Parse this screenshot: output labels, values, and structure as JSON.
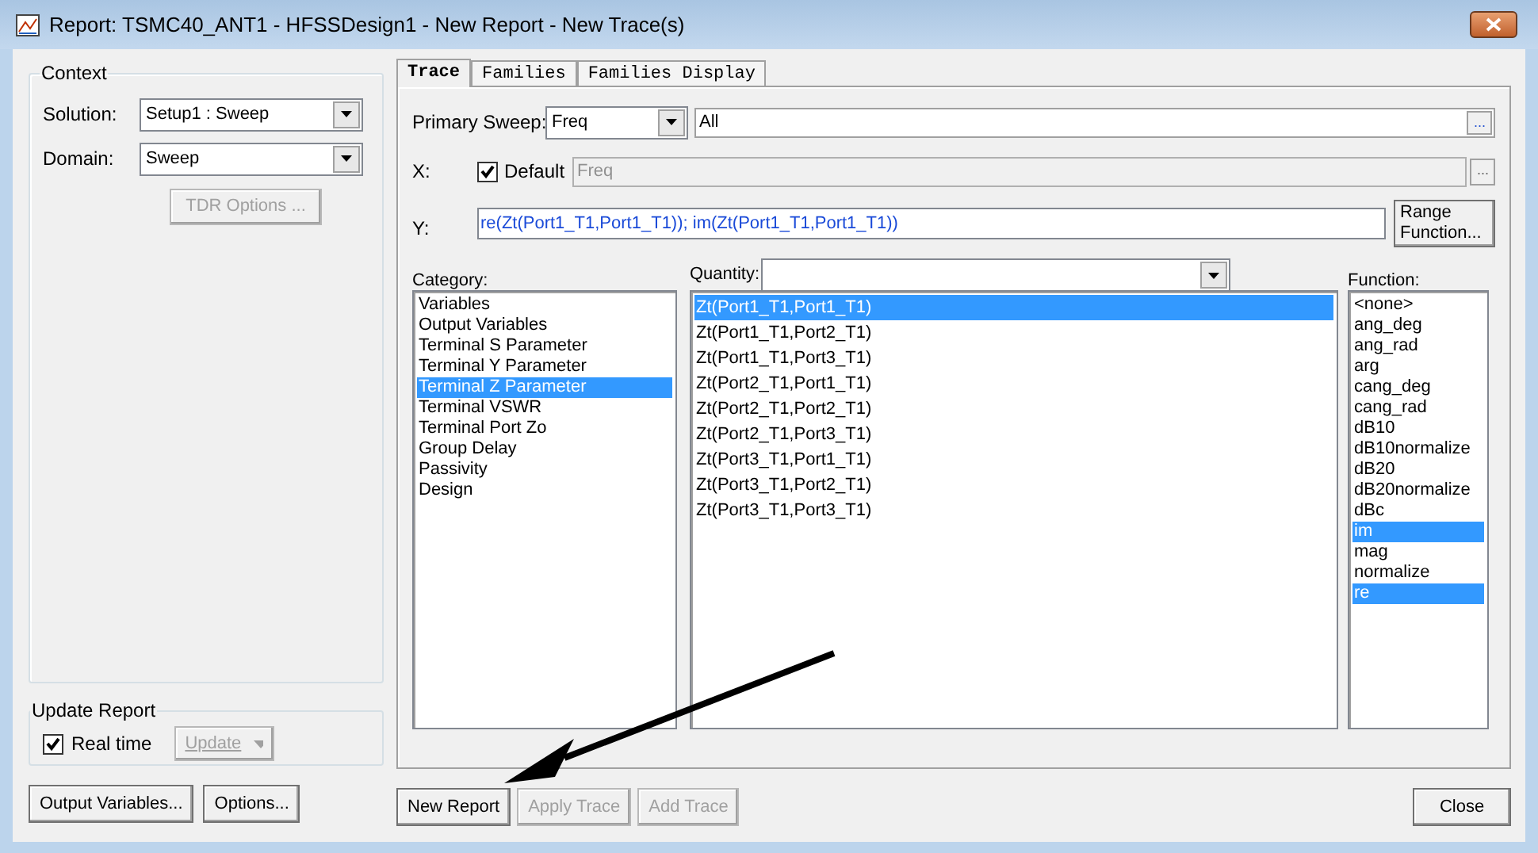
{
  "window": {
    "title": "Report: TSMC40_ANT1 - HFSSDesign1 - New Report - New Trace(s)"
  },
  "context": {
    "title": "Context",
    "fields": [
      {
        "label": "Solution:",
        "value": "Setup1 : Sweep"
      },
      {
        "label": "Domain:",
        "value": "Sweep"
      }
    ],
    "tdr_button": {
      "label": "TDR Options ...",
      "disabled": true
    }
  },
  "update_report": {
    "title": "Update Report",
    "real_time": {
      "label": "Real time",
      "checked": true
    },
    "update_button": {
      "label": "Update",
      "disabled": true
    }
  },
  "left_buttons": [
    {
      "label": "Output Variables...",
      "disabled": false
    },
    {
      "label": "Options...",
      "disabled": false
    }
  ],
  "tabs": [
    {
      "label": "Trace",
      "selected": true
    },
    {
      "label": "Families",
      "selected": false
    },
    {
      "label": "Families Display",
      "selected": false
    }
  ],
  "primary_sweep": {
    "label": "Primary Sweep:",
    "value": "Freq",
    "range": "All",
    "more": "..."
  },
  "x": {
    "label": "X:",
    "default_label": "Default",
    "default_checked": true,
    "value": "Freq",
    "more": "..."
  },
  "y": {
    "label": "Y:",
    "value": "re(Zt(Port1_T1,Port1_T1)); im(Zt(Port1_T1,Port1_T1))",
    "range_button": "Range Function..."
  },
  "category": {
    "label": "Category:",
    "items": [
      {
        "label": "Variables",
        "selected": false
      },
      {
        "label": "Output Variables",
        "selected": false
      },
      {
        "label": "Terminal S Parameter",
        "selected": false
      },
      {
        "label": "Terminal Y Parameter",
        "selected": false
      },
      {
        "label": "Terminal Z Parameter",
        "selected": true
      },
      {
        "label": "Terminal VSWR",
        "selected": false
      },
      {
        "label": "Terminal Port Zo",
        "selected": false
      },
      {
        "label": "Group Delay",
        "selected": false
      },
      {
        "label": "Passivity",
        "selected": false
      },
      {
        "label": "Design",
        "selected": false
      }
    ]
  },
  "quantity": {
    "label": "Quantity:",
    "items": [
      {
        "label": "Zt(Port1_T1,Port1_T1)",
        "selected": true
      },
      {
        "label": "Zt(Port1_T1,Port2_T1)",
        "selected": false
      },
      {
        "label": "Zt(Port1_T1,Port3_T1)",
        "selected": false
      },
      {
        "label": "Zt(Port2_T1,Port1_T1)",
        "selected": false
      },
      {
        "label": "Zt(Port2_T1,Port2_T1)",
        "selected": false
      },
      {
        "label": "Zt(Port2_T1,Port3_T1)",
        "selected": false
      },
      {
        "label": "Zt(Port3_T1,Port1_T1)",
        "selected": false
      },
      {
        "label": "Zt(Port3_T1,Port2_T1)",
        "selected": false
      },
      {
        "label": "Zt(Port3_T1,Port3_T1)",
        "selected": false
      }
    ]
  },
  "function": {
    "label": "Function:",
    "items": [
      {
        "label": "<none>",
        "selected": false
      },
      {
        "label": "ang_deg",
        "selected": false
      },
      {
        "label": "ang_rad",
        "selected": false
      },
      {
        "label": "arg",
        "selected": false
      },
      {
        "label": "cang_deg",
        "selected": false
      },
      {
        "label": "cang_rad",
        "selected": false
      },
      {
        "label": "dB10",
        "selected": false
      },
      {
        "label": "dB10normalize",
        "selected": false
      },
      {
        "label": "dB20",
        "selected": false
      },
      {
        "label": "dB20normalize",
        "selected": false
      },
      {
        "label": "dBc",
        "selected": false
      },
      {
        "label": "im",
        "selected": true
      },
      {
        "label": "mag",
        "selected": false
      },
      {
        "label": "normalize",
        "selected": false
      },
      {
        "label": "re",
        "selected": true
      }
    ]
  },
  "trace_buttons": [
    {
      "label": "New Report",
      "disabled": false
    },
    {
      "label": "Apply Trace",
      "disabled": true
    },
    {
      "label": "Add Trace",
      "disabled": true
    }
  ],
  "close_button": {
    "label": "Close",
    "disabled": false
  }
}
